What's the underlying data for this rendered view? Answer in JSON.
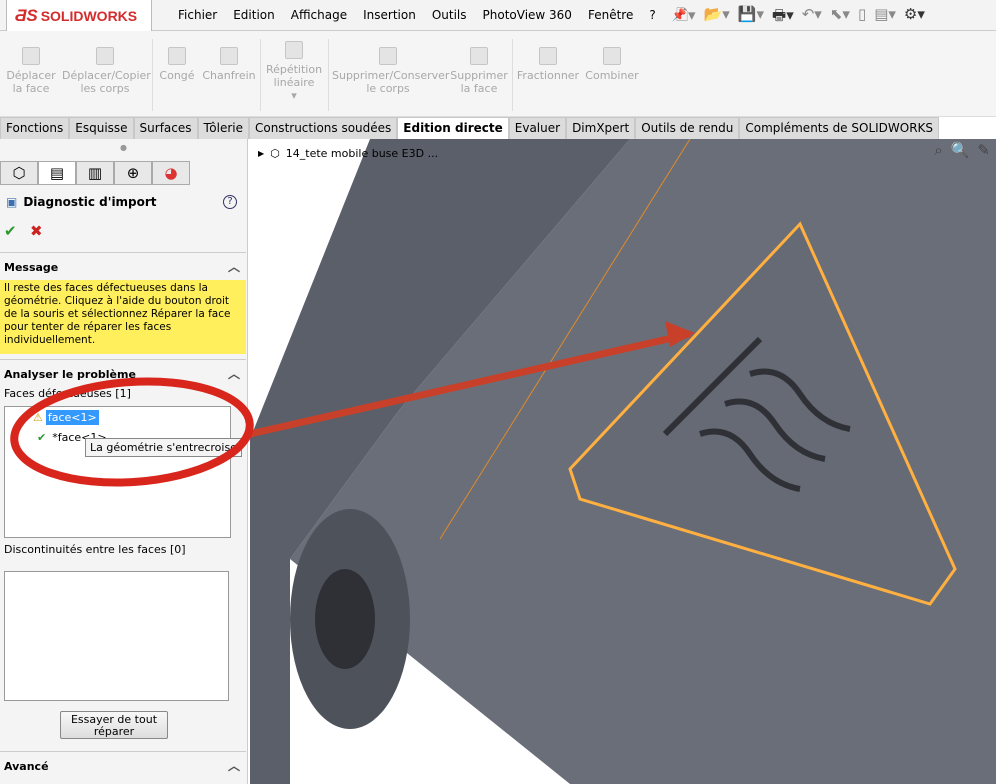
{
  "app": {
    "logo": "SOLIDWORKS",
    "menu": [
      "Fichier",
      "Edition",
      "Affichage",
      "Insertion",
      "Outils",
      "PhotoView 360",
      "Fenêtre",
      "?"
    ],
    "quick_access_icons": [
      "new-icon",
      "open-icon",
      "save-icon",
      "print-icon",
      "undo-icon",
      "select-icon",
      "rebuild-icon",
      "file-properties-icon",
      "options-icon"
    ]
  },
  "commands": [
    {
      "label": "Déplacer\nla face"
    },
    {
      "label": "Déplacer/Copier\nles corps"
    },
    {
      "label": "Congé"
    },
    {
      "label": "Chanfrein"
    },
    {
      "label": "Répétition\nlinéaire"
    },
    {
      "label": "Supprimer/Conserver\nle corps"
    },
    {
      "label": "Supprimer\nla face"
    },
    {
      "label": "Fractionner"
    },
    {
      "label": "Combiner"
    }
  ],
  "tabs": [
    "Fonctions",
    "Esquisse",
    "Surfaces",
    "Tôlerie",
    "Constructions soudées",
    "Edition directe",
    "Evaluer",
    "DimXpert",
    "Outils de rendu",
    "Compléments de SOLIDWORKS"
  ],
  "active_tab": "Edition directe",
  "panel": {
    "title": "Diagnostic d'import",
    "message_header": "Message",
    "message": "Il reste des faces défectueuses dans la géométrie. Cliquez à l'aide du bouton droit de la souris et sélectionnez Réparer la face pour tenter de réparer les faces individuellement.",
    "analyze_header": "Analyser le problème",
    "faulty_faces_label": "Faces défectueuses [1]",
    "faulty_items": [
      "face<1>",
      "*face<1>"
    ],
    "tooltip": "La géométrie s'entrecroise",
    "gaps_label": "Discontinuités entre les faces [0]",
    "repair_all": "Essayer de tout\nréparer",
    "advanced_header": "Avancé"
  },
  "tree": {
    "root": "14_tete mobile buse E3D ..."
  },
  "colors": {
    "accent": "#d42b2b",
    "selection": "#3399ff",
    "message_bg": "#ffef5c",
    "annotation": "#d9261c"
  }
}
